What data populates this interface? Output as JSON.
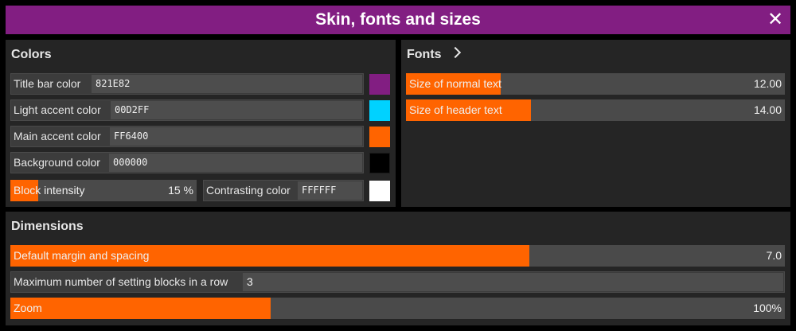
{
  "window": {
    "title": "Skin, fonts and sizes"
  },
  "colors_panel": {
    "title": "Colors",
    "title_bar_color": {
      "label": "Title bar color",
      "value": "821E82",
      "swatch": "#821E82"
    },
    "light_accent_color": {
      "label": "Light accent color",
      "value": "00D2FF",
      "swatch": "#00D2FF"
    },
    "main_accent_color": {
      "label": "Main accent color",
      "value": "FF6400",
      "swatch": "#FF6400"
    },
    "background_color": {
      "label": "Background color",
      "value": "000000",
      "swatch": "#000000"
    },
    "block_intensity": {
      "label": "Block intensity",
      "value": "15 %",
      "fraction": 0.15
    },
    "contrasting_color": {
      "label": "Contrasting color",
      "value": "FFFFFF",
      "swatch": "#FFFFFF"
    }
  },
  "fonts_panel": {
    "title": "Fonts",
    "normal_text": {
      "label": "Size of normal text",
      "value": "12.00",
      "fraction": 0.25
    },
    "header_text": {
      "label": "Size of header text",
      "value": "14.00",
      "fraction": 0.33
    }
  },
  "dimensions_panel": {
    "title": "Dimensions",
    "margin_spacing": {
      "label": "Default margin and spacing",
      "value": "7.0",
      "fraction": 0.67
    },
    "max_blocks": {
      "label": "Maximum number of setting blocks in a row",
      "value": "3"
    },
    "zoom": {
      "label": "Zoom",
      "value": "100%",
      "fraction": 0.336
    }
  }
}
